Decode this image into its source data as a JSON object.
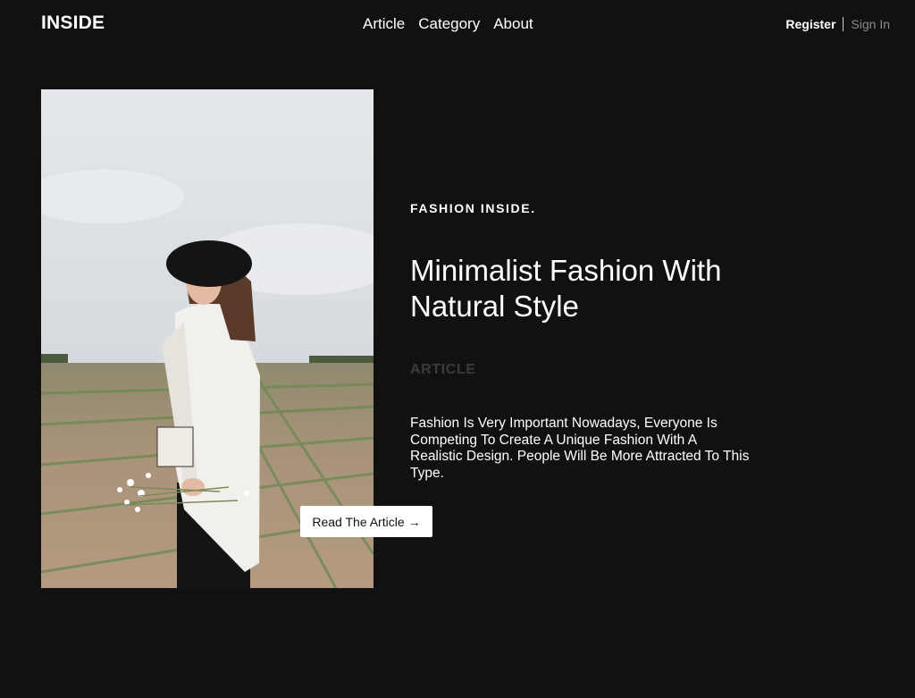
{
  "header": {
    "brand": "INSIDE",
    "nav": {
      "article": "Article",
      "category": "Category",
      "about": "About"
    },
    "auth": {
      "register": "Register",
      "sign_in": "Sign In"
    }
  },
  "hero": {
    "kicker": "FASHION INSIDE.",
    "title": "Minimalist Fashion With Natural Style",
    "category": "ARTICLE",
    "description": "Fashion Is Very Important Nowadays, Everyone Is Competing To Create A Unique Fashion With A Realistic Design. People Will Be More Attracted To This Type.",
    "cta_label": "Read The Article",
    "cta_icon": "→",
    "image_icon": "fashion-photo"
  },
  "colors": {
    "background": "#111112",
    "text": "#ffffff",
    "muted": "#3b3b3c",
    "button_bg": "#ffffff"
  }
}
